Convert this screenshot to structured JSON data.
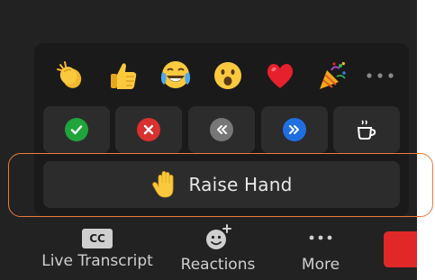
{
  "colors": {
    "background": "#222222",
    "panel": "#1a1a1a",
    "button": "#2c2c2c",
    "accent_highlight": "#ea7a3c",
    "end_button": "#e02828",
    "green": "#1fa53b",
    "red": "#d93030",
    "grey": "#777777",
    "blue": "#1f6fe0"
  },
  "reactions": {
    "emojis": [
      {
        "icon": "clapping-hands-icon"
      },
      {
        "icon": "thumbs-up-icon"
      },
      {
        "icon": "tears-of-joy-icon"
      },
      {
        "icon": "open-mouth-icon"
      },
      {
        "icon": "red-heart-icon"
      },
      {
        "icon": "party-popper-icon"
      }
    ],
    "more_icon": "more-dots-icon"
  },
  "status_buttons": [
    {
      "icon": "check-icon",
      "color": "#1fa53b"
    },
    {
      "icon": "x-icon",
      "color": "#d93030"
    },
    {
      "icon": "slower-icon",
      "color": "#777777"
    },
    {
      "icon": "faster-icon",
      "color": "#1f6fe0"
    },
    {
      "icon": "coffee-cup-icon"
    }
  ],
  "raise_hand": {
    "label": "Raise Hand",
    "icon": "raised-hand-icon"
  },
  "toolbar": {
    "live_transcript": {
      "label": "Live Transcript",
      "icon_text": "CC"
    },
    "reactions": {
      "label": "Reactions",
      "icon": "add-reaction-icon"
    },
    "more": {
      "label": "More",
      "icon": "more-dots-icon"
    },
    "end": {
      "icon": "end-meeting-button"
    }
  }
}
